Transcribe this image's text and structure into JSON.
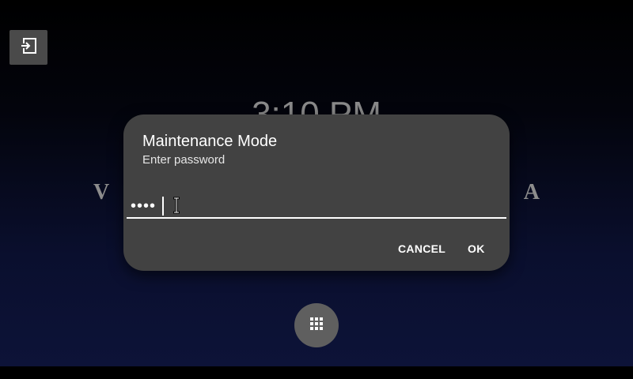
{
  "background": {
    "clock_text": "3:10 PM",
    "brand_left": "V",
    "brand_right": "A"
  },
  "toolbar": {
    "exit_icon": "exit-icon"
  },
  "dialog": {
    "title": "Maintenance Mode",
    "message": "Enter password",
    "password_masked": "••••",
    "cancel_label": "CANCEL",
    "ok_label": "OK"
  },
  "keypad": {
    "icon": "dialpad-icon"
  },
  "colors": {
    "dialog_bg": "#424242",
    "accent_text": "#ffffff",
    "button_bg": "#4a4a4a",
    "keypad_bg": "#5f5f5f"
  }
}
